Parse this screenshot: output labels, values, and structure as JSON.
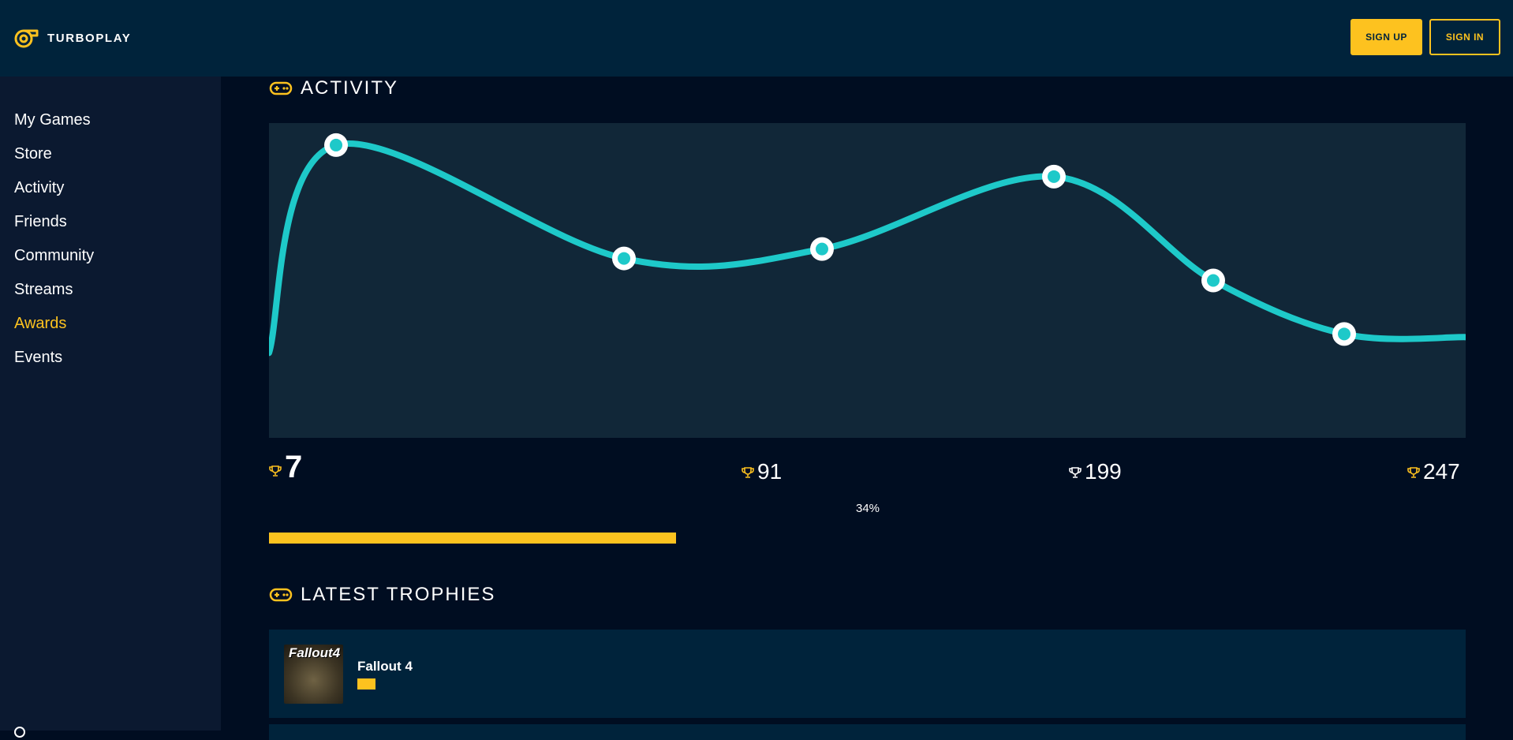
{
  "brand": {
    "name": "TURBOPLAY",
    "accent_color": "#fdc21f",
    "logo_icon": "turbo-icon"
  },
  "header": {
    "signup_label": "SIGN UP",
    "signin_label": "SIGN IN"
  },
  "sidebar": {
    "items": [
      {
        "label": "My Games",
        "active": false
      },
      {
        "label": "Store",
        "active": false
      },
      {
        "label": "Activity",
        "active": false
      },
      {
        "label": "Friends",
        "active": false
      },
      {
        "label": "Community",
        "active": false
      },
      {
        "label": "Streams",
        "active": false
      },
      {
        "label": "Awards",
        "active": true
      },
      {
        "label": "Events",
        "active": false
      }
    ]
  },
  "activity": {
    "title": "ACTIVITY",
    "icon": "gamepad-icon",
    "chart_data": {
      "type": "line",
      "curve": "smooth",
      "x": [
        0,
        1,
        2,
        3,
        4,
        5,
        6,
        7
      ],
      "y": [
        27,
        93,
        57,
        60,
        83,
        50,
        33,
        32
      ],
      "marked_points": [
        1,
        2,
        3,
        4,
        5,
        6
      ],
      "ylim": [
        0,
        100
      ],
      "line_color": "#1ec9c9",
      "grid": false
    },
    "stats": [
      {
        "value": "7",
        "icon": "trophy-icon",
        "emphasis": true
      },
      {
        "value": "91",
        "icon": "trophy-icon"
      },
      {
        "value": "199",
        "icon": "trophy-icon",
        "color": "#ffffff"
      },
      {
        "value": "247",
        "icon": "trophy-icon"
      }
    ],
    "progress": {
      "label": "34%",
      "value": 0.34
    }
  },
  "latest_trophies": {
    "title": "LATEST TROPHIES",
    "icon": "gamepad-icon",
    "items": [
      {
        "game": "Fallout 4",
        "thumb_text": "Fallout4",
        "progress": 0.02
      }
    ]
  }
}
